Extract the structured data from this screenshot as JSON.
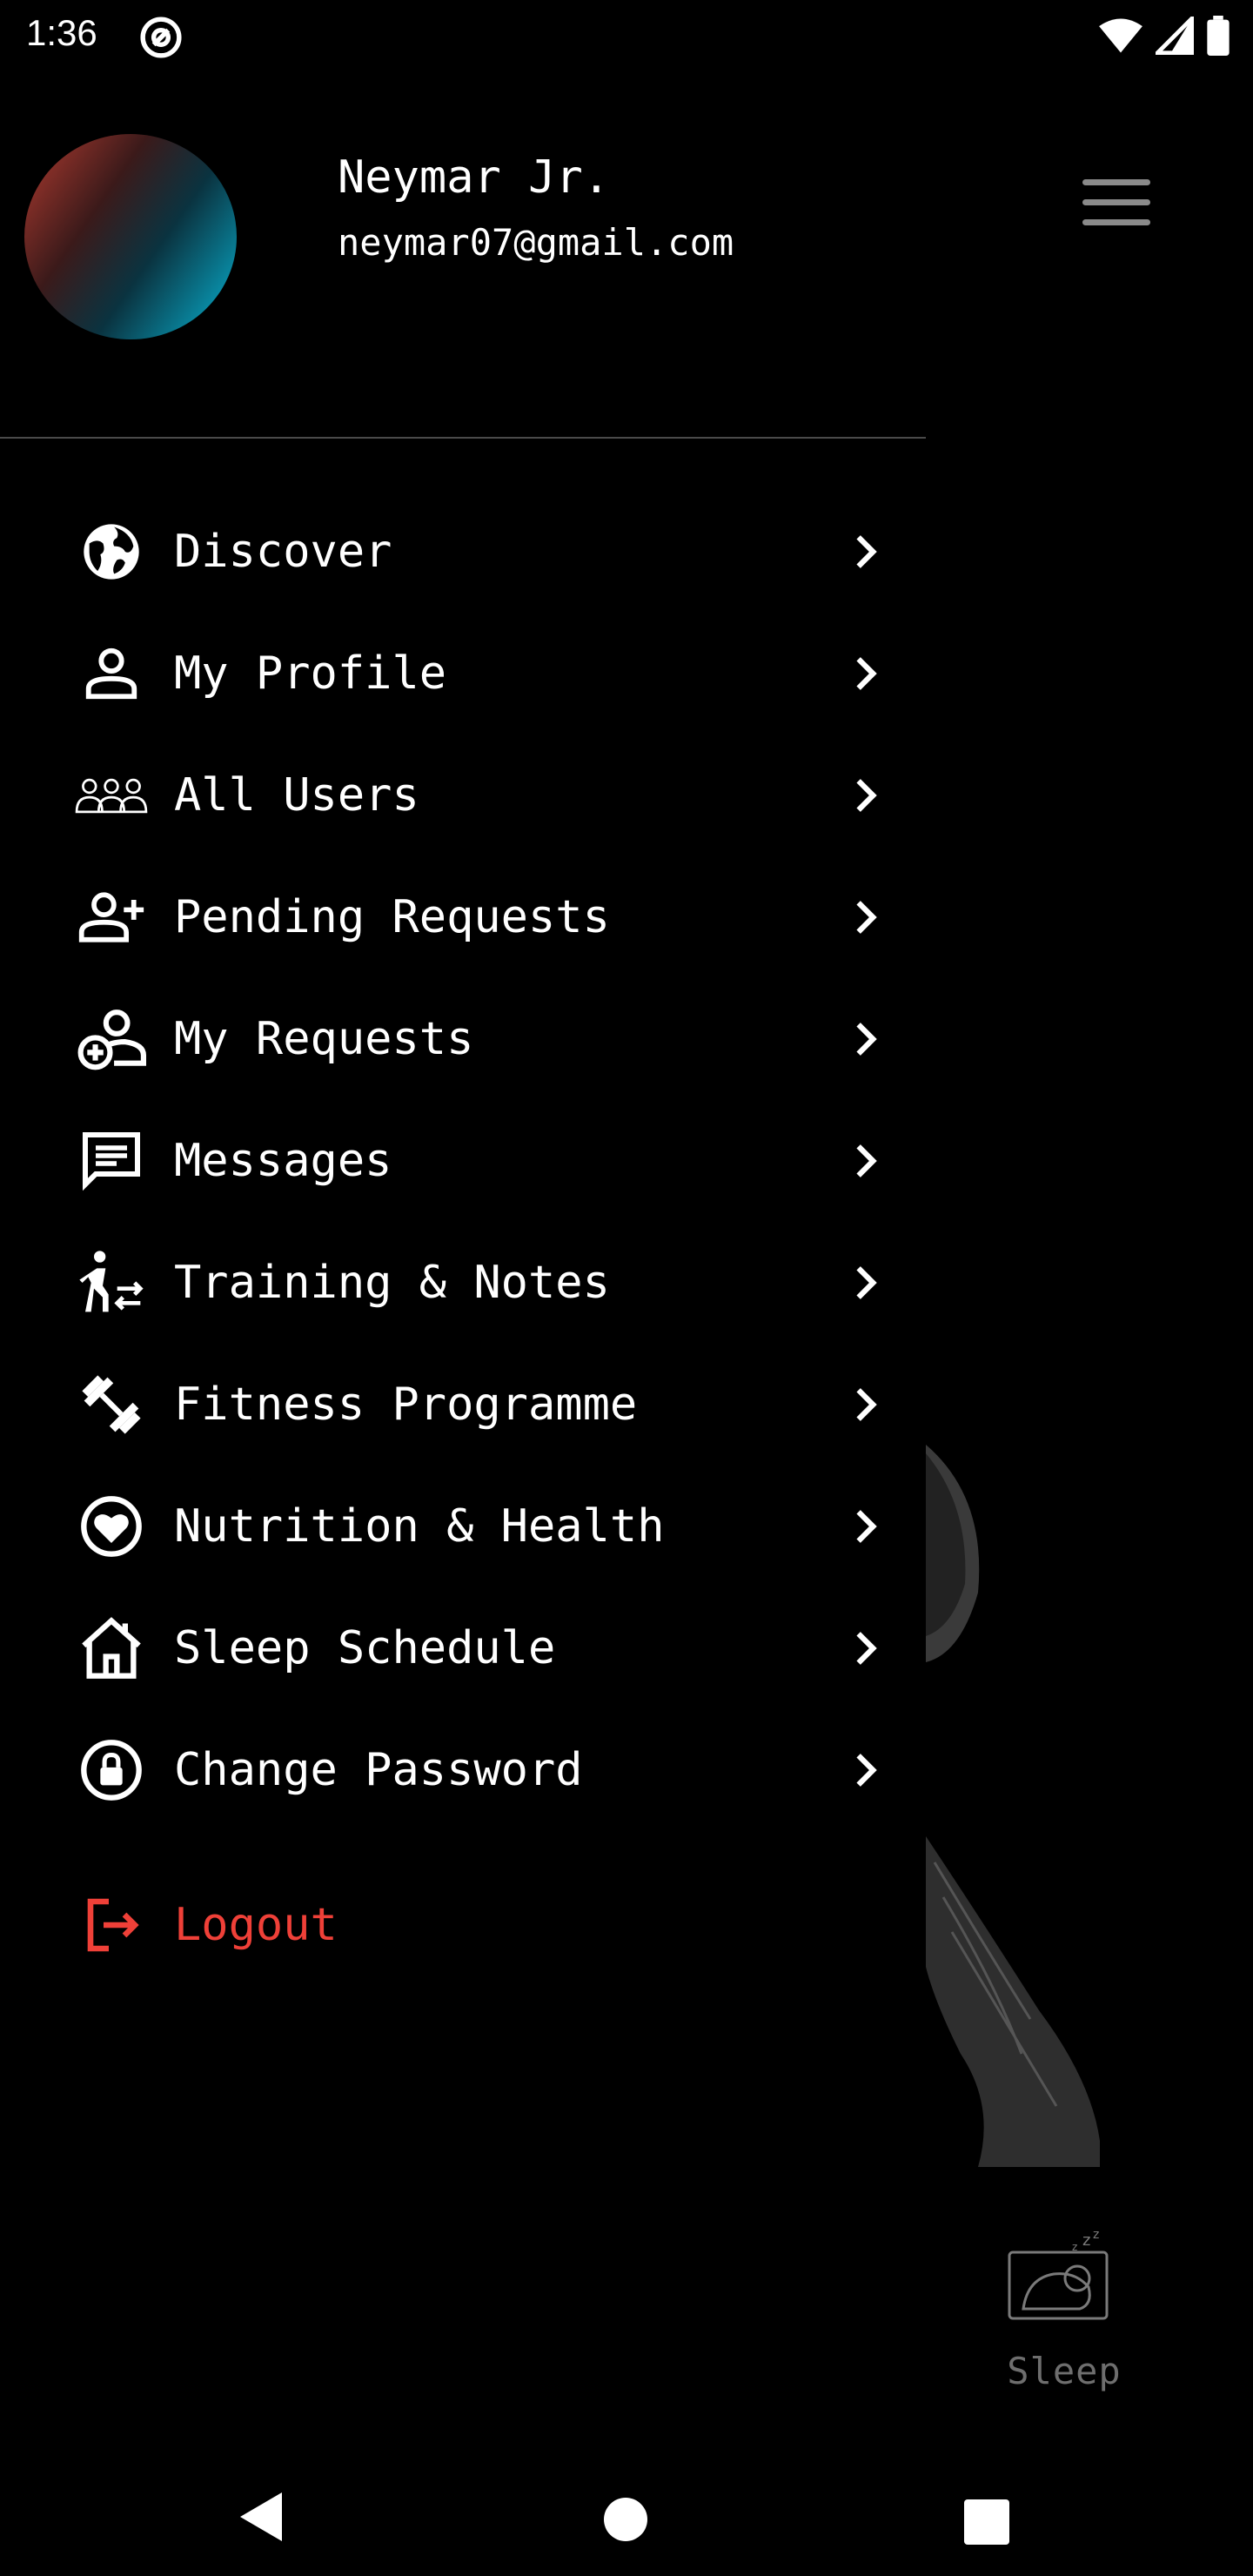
{
  "status_bar": {
    "time": "1:36"
  },
  "user": {
    "name": "Neymar Jr.",
    "email": "neymar07@gmail.com"
  },
  "menu": [
    {
      "label": "Discover",
      "icon": "globe-icon"
    },
    {
      "label": "My Profile",
      "icon": "person-icon"
    },
    {
      "label": "All Users",
      "icon": "group-icon"
    },
    {
      "label": "Pending Requests",
      "icon": "person-add-icon"
    },
    {
      "label": "My Requests",
      "icon": "person-request-icon"
    },
    {
      "label": "Messages",
      "icon": "message-icon"
    },
    {
      "label": "Training & Notes",
      "icon": "walk-icon"
    },
    {
      "label": "Fitness Programme",
      "icon": "dumbbell-icon"
    },
    {
      "label": "Nutrition & Health",
      "icon": "heart-icon"
    },
    {
      "label": "Sleep Schedule",
      "icon": "home-icon"
    },
    {
      "label": "Change Password",
      "icon": "lock-icon"
    }
  ],
  "logout": {
    "label": "Logout",
    "icon": "logout-icon",
    "color": "#ef4038"
  },
  "background_screen": {
    "tab_label": "Sleep"
  }
}
